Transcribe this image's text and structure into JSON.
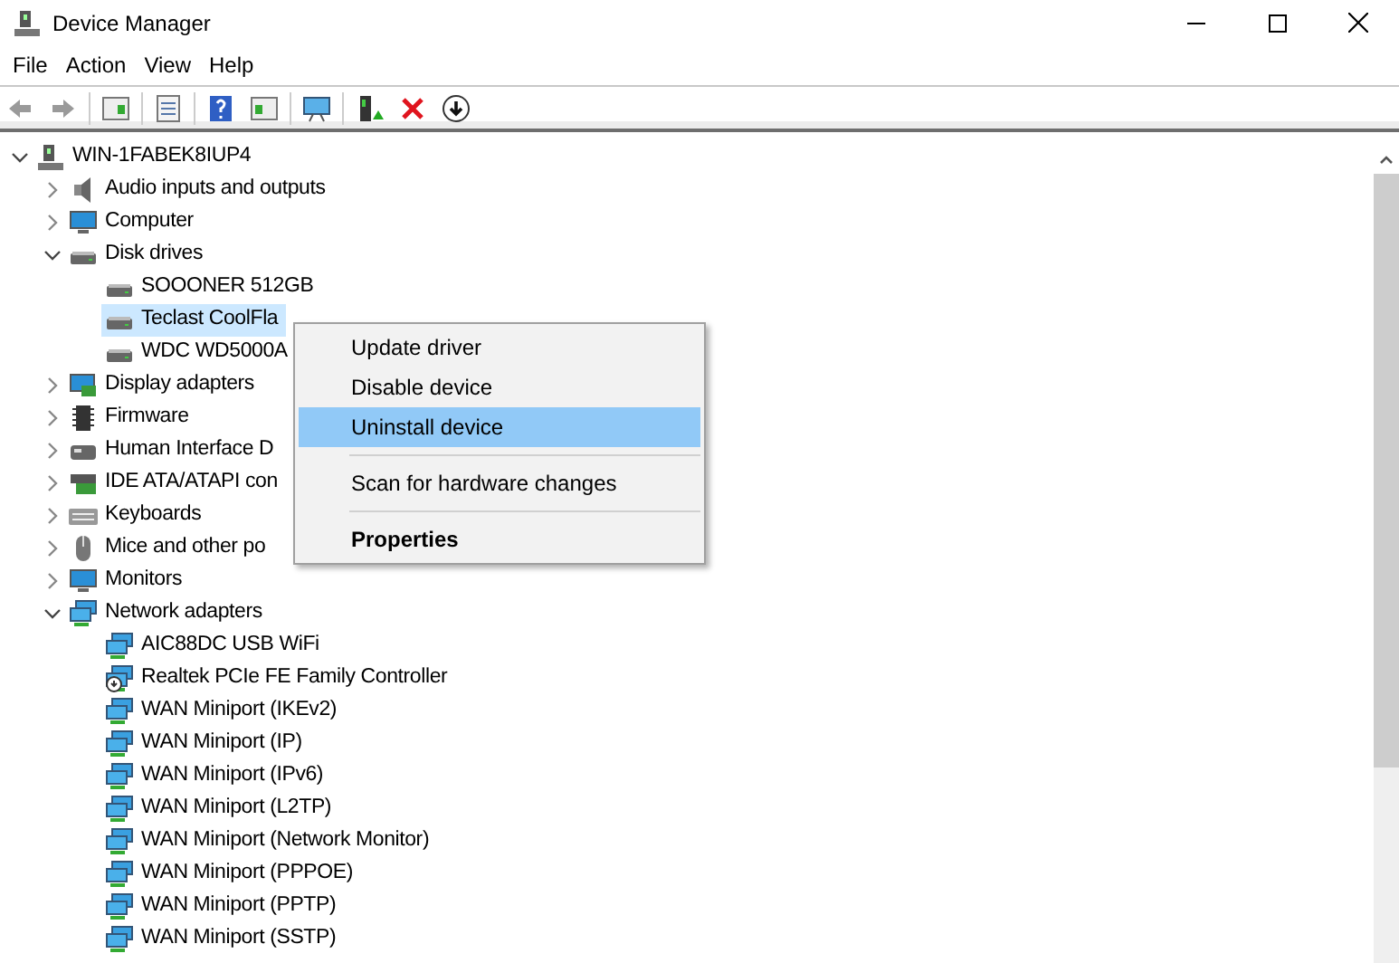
{
  "window": {
    "title": "Device Manager"
  },
  "menu_bar": [
    "File",
    "Action",
    "View",
    "Help"
  ],
  "tree": {
    "label": "WIN-1FABEK8IUP4",
    "kind": "computer-root",
    "expanded": true,
    "selected": false,
    "children": [
      {
        "label": "Audio inputs and outputs",
        "kind": "audio",
        "expanded": false,
        "selected": false
      },
      {
        "label": "Computer",
        "kind": "monitor",
        "expanded": false,
        "selected": false
      },
      {
        "label": "Disk drives",
        "kind": "disk",
        "expanded": true,
        "selected": false,
        "children": [
          {
            "label": "SOOONER  512GB",
            "kind": "disk",
            "selected": false
          },
          {
            "label": "Teclast CoolFla",
            "kind": "disk",
            "selected": true
          },
          {
            "label": "WDC WD5000A",
            "kind": "disk",
            "selected": false
          }
        ]
      },
      {
        "label": "Display adapters",
        "kind": "display",
        "expanded": false,
        "selected": false
      },
      {
        "label": "Firmware",
        "kind": "chip",
        "expanded": false,
        "selected": false
      },
      {
        "label": "Human Interface D",
        "kind": "hid",
        "expanded": false,
        "selected": false
      },
      {
        "label": "IDE ATA/ATAPI con",
        "kind": "ide",
        "expanded": false,
        "selected": false
      },
      {
        "label": "Keyboards",
        "kind": "keyboard",
        "expanded": false,
        "selected": false
      },
      {
        "label": "Mice and other po",
        "kind": "mouse",
        "expanded": false,
        "selected": false
      },
      {
        "label": "Monitors",
        "kind": "monitor",
        "expanded": false,
        "selected": false
      },
      {
        "label": "Network adapters",
        "kind": "network",
        "expanded": true,
        "selected": false,
        "children": [
          {
            "label": "AIC88DC USB WiFi",
            "kind": "network",
            "selected": false
          },
          {
            "label": "Realtek PCIe FE Family Controller",
            "kind": "network-disabled",
            "selected": false
          },
          {
            "label": "WAN Miniport (IKEv2)",
            "kind": "network",
            "selected": false
          },
          {
            "label": "WAN Miniport (IP)",
            "kind": "network",
            "selected": false
          },
          {
            "label": "WAN Miniport (IPv6)",
            "kind": "network",
            "selected": false
          },
          {
            "label": "WAN Miniport (L2TP)",
            "kind": "network",
            "selected": false
          },
          {
            "label": "WAN Miniport (Network Monitor)",
            "kind": "network",
            "selected": false
          },
          {
            "label": "WAN Miniport (PPPOE)",
            "kind": "network",
            "selected": false
          },
          {
            "label": "WAN Miniport (PPTP)",
            "kind": "network",
            "selected": false
          },
          {
            "label": "WAN Miniport (SSTP)",
            "kind": "network",
            "selected": false
          }
        ]
      }
    ]
  },
  "context_menu": [
    {
      "kind": "item",
      "label": "Update driver",
      "selected": false
    },
    {
      "kind": "item",
      "label": "Disable device",
      "selected": false
    },
    {
      "kind": "item",
      "label": "Uninstall device",
      "selected": true
    },
    {
      "kind": "separator"
    },
    {
      "kind": "item",
      "label": "Scan for hardware changes",
      "selected": false
    },
    {
      "kind": "separator"
    },
    {
      "kind": "default",
      "label": "Properties",
      "selected": false
    }
  ]
}
